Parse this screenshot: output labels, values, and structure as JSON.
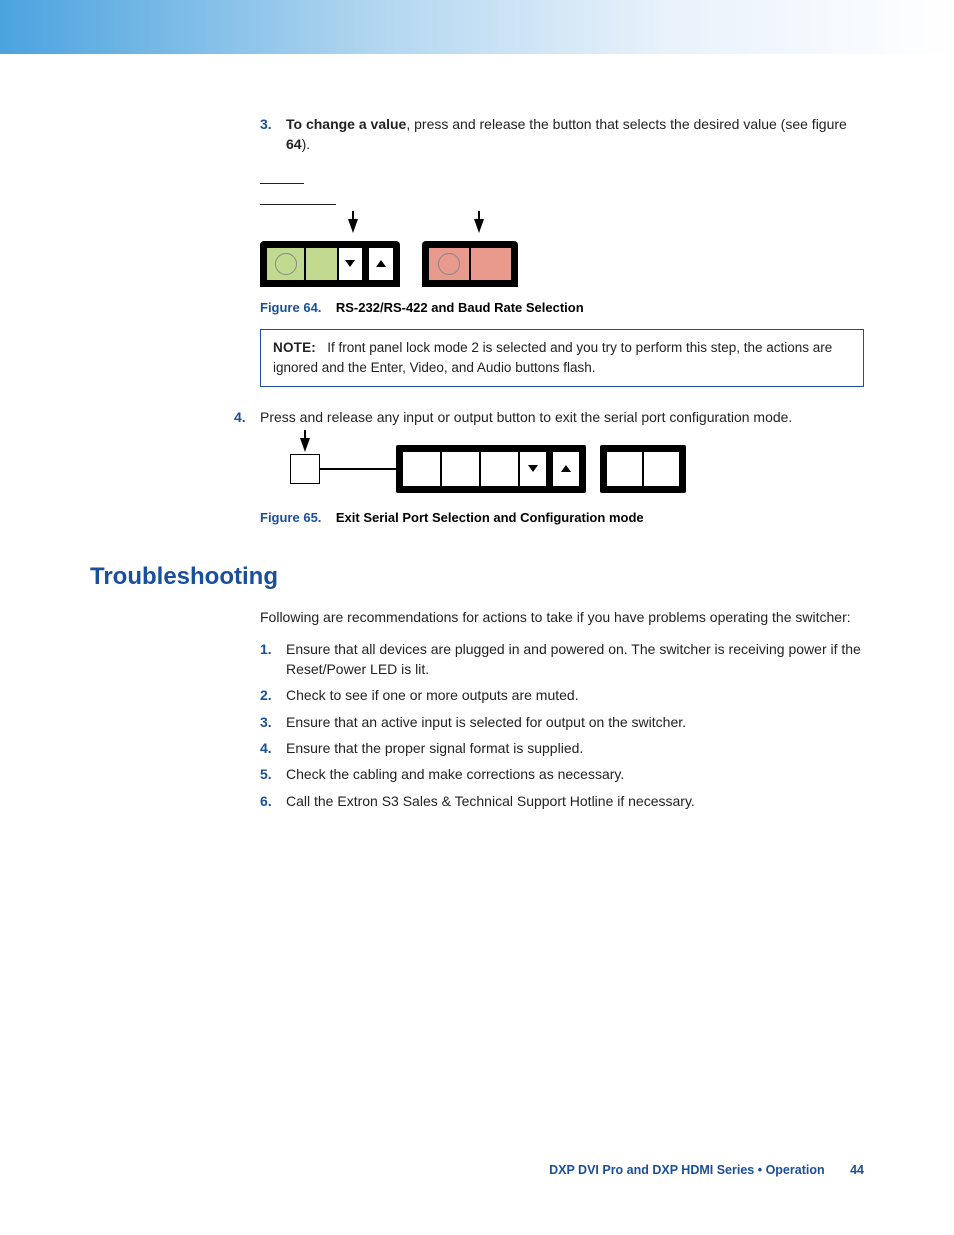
{
  "step3": {
    "num": "3.",
    "bold_lead": "To change a value",
    "rest": ", press and release the button that selects the desired value (see figure ",
    "figref": "64",
    "rest2": ")."
  },
  "fig64": {
    "label": "Figure 64.",
    "title": "RS-232/RS-422 and Baud Rate Selection"
  },
  "note": {
    "label": "NOTE:",
    "text": "If front panel lock mode 2 is selected and you try to perform this step, the actions are ignored and the Enter, Video, and Audio buttons flash."
  },
  "step4": {
    "num": "4.",
    "text": "Press and release any input or output button to exit the serial port configuration mode."
  },
  "fig65": {
    "label": "Figure 65.",
    "prefix": "Exit ",
    "bold": "Serial Port Selection and Configuration",
    "suffix": " mode"
  },
  "troubleshooting": {
    "heading": "Troubleshooting",
    "intro": "Following are recommendations for actions to take if you have problems operating the switcher:",
    "items": [
      "Ensure that all devices are plugged in and powered on. The switcher is receiving power if the Reset/Power LED is lit.",
      "Check to see if one or more outputs are muted.",
      "Ensure that an active input is selected for output on the switcher.",
      "Ensure that the proper signal format is supplied.",
      "Check the cabling and make corrections as necessary.",
      "Call the Extron S3 Sales & Technical Support Hotline if necessary."
    ],
    "nums": [
      "1.",
      "2.",
      "3.",
      "4.",
      "5.",
      "6."
    ]
  },
  "footer": {
    "text": "DXP DVI Pro and DXP HDMI Series • Operation",
    "page": "44"
  }
}
